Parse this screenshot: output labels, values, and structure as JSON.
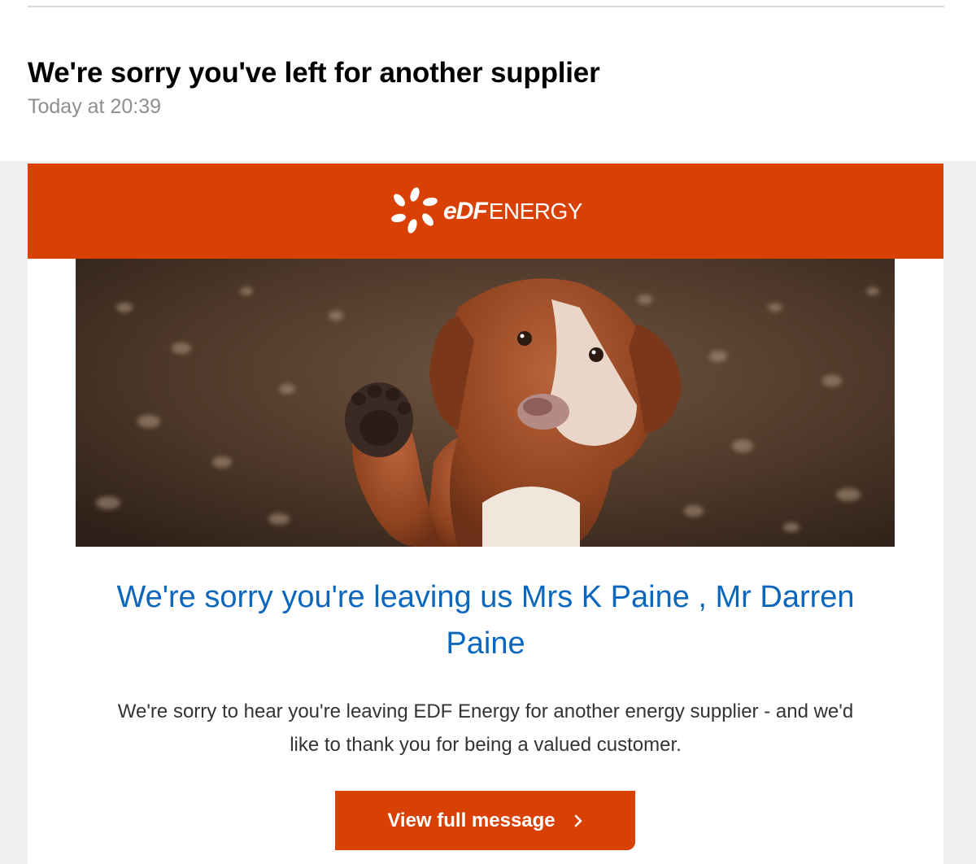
{
  "header": {
    "subject": "We're sorry you've left for another supplier",
    "date": "Today at 20:39"
  },
  "email": {
    "brand": {
      "name_part1": "eDF",
      "name_part2": "ENERGY",
      "logo_icon": "edf-swirl-icon",
      "color": "#d94104"
    },
    "hero_image": "dog-raising-paw-photo",
    "headline": "We're sorry you're leaving us Mrs K Paine , Mr Darren Paine",
    "body": "We're sorry to hear you're leaving EDF Energy for another energy supplier - and we'd like to thank you for being a valued customer.",
    "cta": {
      "label": "View full message",
      "icon": "chevron-right-icon"
    },
    "colors": {
      "headline": "#0b67bd",
      "accent": "#d94104"
    }
  }
}
